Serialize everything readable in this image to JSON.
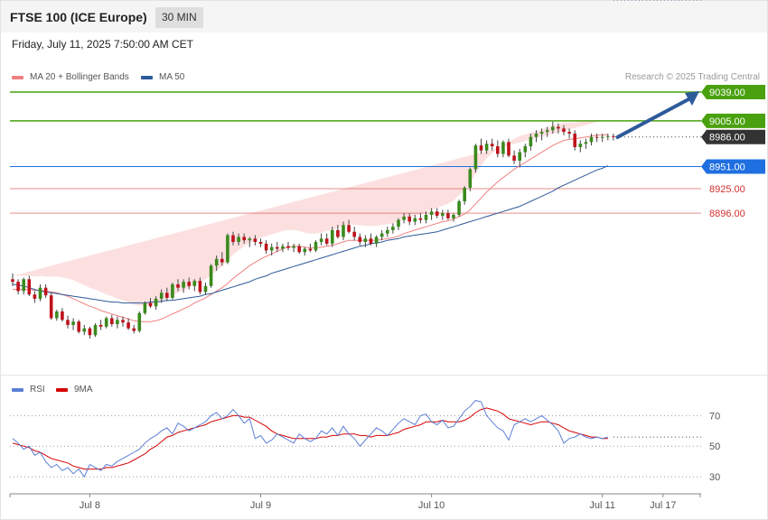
{
  "header": {
    "title": "FTSE 100 (ICE Europe)",
    "timeframe": "30 MIN"
  },
  "datetime": "Friday, July 11, 2025 7:50:00 AM CET",
  "legend": {
    "ma20": {
      "label": "MA 20 + Bollinger Bands",
      "color": "#f08080"
    },
    "ma50": {
      "label": "MA 50",
      "color": "#2d5a9a"
    }
  },
  "credit": "Research © 2025 Trading Central",
  "rsi_legend": {
    "rsi": {
      "label": "RSI",
      "color": "#5b7fd6"
    },
    "ma9": {
      "label": "9MA",
      "color": "#d60000"
    }
  },
  "chart_data": {
    "type": "candlestick",
    "ylim": [
      8700,
      9055
    ],
    "levels": [
      {
        "value": 9039.0,
        "label": "9039.00",
        "kind": "resistance",
        "color": "#4aa10f"
      },
      {
        "value": 9005.0,
        "label": "9005.00",
        "kind": "resistance",
        "color": "#4aa10f"
      },
      {
        "value": 8986.0,
        "label": "8986.00",
        "kind": "current",
        "color": "#333333"
      },
      {
        "value": 8951.0,
        "label": "8951.00",
        "kind": "support",
        "color": "#1f6fe0"
      },
      {
        "value": 8925.0,
        "label": "8925.00",
        "kind": "support",
        "color": "#d32f2f"
      },
      {
        "value": 8896.0,
        "label": "8896.00",
        "kind": "support",
        "color": "#d32f2f"
      }
    ],
    "candles": [
      [
        8818,
        8825,
        8810,
        8815
      ],
      [
        8815,
        8818,
        8800,
        8804
      ],
      [
        8804,
        8820,
        8800,
        8818
      ],
      [
        8818,
        8822,
        8798,
        8800
      ],
      [
        8800,
        8804,
        8790,
        8795
      ],
      [
        8795,
        8812,
        8792,
        8808
      ],
      [
        8808,
        8812,
        8796,
        8799
      ],
      [
        8799,
        8802,
        8770,
        8772
      ],
      [
        8772,
        8782,
        8769,
        8780
      ],
      [
        8780,
        8784,
        8768,
        8770
      ],
      [
        8770,
        8775,
        8760,
        8764
      ],
      [
        8764,
        8772,
        8758,
        8768
      ],
      [
        8768,
        8770,
        8754,
        8756
      ],
      [
        8756,
        8764,
        8752,
        8760
      ],
      [
        8760,
        8762,
        8748,
        8752
      ],
      [
        8752,
        8766,
        8750,
        8764
      ],
      [
        8764,
        8770,
        8758,
        8762
      ],
      [
        8762,
        8774,
        8760,
        8772
      ],
      [
        8772,
        8776,
        8762,
        8765
      ],
      [
        8765,
        8774,
        8760,
        8770
      ],
      [
        8770,
        8774,
        8762,
        8767
      ],
      [
        8767,
        8772,
        8758,
        8760
      ],
      [
        8760,
        8764,
        8754,
        8757
      ],
      [
        8757,
        8780,
        8755,
        8778
      ],
      [
        8778,
        8792,
        8776,
        8790
      ],
      [
        8790,
        8796,
        8784,
        8786
      ],
      [
        8786,
        8798,
        8782,
        8795
      ],
      [
        8795,
        8806,
        8790,
        8802
      ],
      [
        8802,
        8808,
        8792,
        8796
      ],
      [
        8796,
        8814,
        8794,
        8812
      ],
      [
        8812,
        8818,
        8804,
        8808
      ],
      [
        8808,
        8818,
        8802,
        8815
      ],
      [
        8815,
        8820,
        8806,
        8810
      ],
      [
        8810,
        8818,
        8804,
        8816
      ],
      [
        8816,
        8820,
        8800,
        8803
      ],
      [
        8803,
        8814,
        8800,
        8810
      ],
      [
        8810,
        8836,
        8808,
        8834
      ],
      [
        8834,
        8846,
        8828,
        8842
      ],
      [
        8842,
        8850,
        8834,
        8838
      ],
      [
        8838,
        8872,
        8836,
        8870
      ],
      [
        8870,
        8874,
        8858,
        8862
      ],
      [
        8862,
        8872,
        8858,
        8868
      ],
      [
        8868,
        8872,
        8860,
        8864
      ],
      [
        8864,
        8868,
        8856,
        8866
      ],
      [
        8866,
        8870,
        8858,
        8862
      ],
      [
        8862,
        8866,
        8856,
        8860
      ],
      [
        8860,
        8864,
        8848,
        8852
      ],
      [
        8852,
        8860,
        8846,
        8856
      ],
      [
        8856,
        8862,
        8850,
        8854
      ],
      [
        8854,
        8860,
        8850,
        8857
      ],
      [
        8857,
        8862,
        8852,
        8855
      ],
      [
        8855,
        8860,
        8850,
        8857
      ],
      [
        8857,
        8860,
        8848,
        8850
      ],
      [
        8850,
        8856,
        8846,
        8854
      ],
      [
        8854,
        8860,
        8850,
        8852
      ],
      [
        8852,
        8864,
        8850,
        8862
      ],
      [
        8862,
        8872,
        8858,
        8866
      ],
      [
        8866,
        8872,
        8858,
        8860
      ],
      [
        8860,
        8880,
        8856,
        8876
      ],
      [
        8876,
        8882,
        8866,
        8868
      ],
      [
        8868,
        8886,
        8864,
        8882
      ],
      [
        8882,
        8888,
        8872,
        8874
      ],
      [
        8874,
        8880,
        8864,
        8868
      ],
      [
        8868,
        8872,
        8858,
        8862
      ],
      [
        8862,
        8870,
        8856,
        8866
      ],
      [
        8866,
        8872,
        8858,
        8860
      ],
      [
        8860,
        8870,
        8856,
        8868
      ],
      [
        8868,
        8876,
        8864,
        8872
      ],
      [
        8872,
        8880,
        8868,
        8876
      ],
      [
        8876,
        8884,
        8872,
        8880
      ],
      [
        8880,
        8890,
        8876,
        8888
      ],
      [
        8888,
        8896,
        8884,
        8892
      ],
      [
        8892,
        8896,
        8882,
        8886
      ],
      [
        8886,
        8894,
        8882,
        8890
      ],
      [
        8890,
        8896,
        8884,
        8888
      ],
      [
        8888,
        8898,
        8884,
        8894
      ],
      [
        8894,
        8902,
        8888,
        8898
      ],
      [
        8898,
        8902,
        8890,
        8893
      ],
      [
        8893,
        8900,
        8888,
        8896
      ],
      [
        8896,
        8900,
        8888,
        8890
      ],
      [
        8890,
        8896,
        8886,
        8894
      ],
      [
        8894,
        8912,
        8892,
        8910
      ],
      [
        8910,
        8928,
        8906,
        8926
      ],
      [
        8926,
        8950,
        8922,
        8948
      ],
      [
        8948,
        8978,
        8944,
        8976
      ],
      [
        8976,
        8984,
        8966,
        8970
      ],
      [
        8970,
        8982,
        8966,
        8978
      ],
      [
        8978,
        8984,
        8970,
        8975
      ],
      [
        8975,
        8982,
        8962,
        8966
      ],
      [
        8966,
        8982,
        8962,
        8980
      ],
      [
        8980,
        8984,
        8962,
        8964
      ],
      [
        8964,
        8970,
        8954,
        8958
      ],
      [
        8958,
        8972,
        8950,
        8968
      ],
      [
        8968,
        8978,
        8962,
        8975
      ],
      [
        8975,
        8990,
        8970,
        8986
      ],
      [
        8986,
        8994,
        8980,
        8990
      ],
      [
        8990,
        8996,
        8982,
        8992
      ],
      [
        8992,
        8998,
        8986,
        8994
      ],
      [
        8994,
        9004,
        8990,
        8998
      ],
      [
        8998,
        9002,
        8990,
        8996
      ],
      [
        8996,
        9000,
        8988,
        8992
      ],
      [
        8992,
        8996,
        8984,
        8990
      ],
      [
        8990,
        8994,
        8970,
        8974
      ],
      [
        8974,
        8982,
        8968,
        8978
      ],
      [
        8978,
        8984,
        8972,
        8980
      ],
      [
        8980,
        8990,
        8976,
        8986
      ],
      [
        8986,
        8990,
        8980,
        8985
      ],
      [
        8985,
        8990,
        8980,
        8986
      ],
      [
        8986,
        8990,
        8982,
        8987
      ],
      [
        8987,
        8990,
        8982,
        8986
      ]
    ],
    "ma20": [
      8806,
      8806,
      8806,
      8806,
      8805,
      8805,
      8804,
      8803,
      8802,
      8800,
      8798,
      8795,
      8792,
      8789,
      8786,
      8784,
      8781,
      8779,
      8777,
      8775,
      8773,
      8771,
      8769,
      8768,
      8768,
      8768,
      8769,
      8771,
      8774,
      8777,
      8780,
      8783,
      8786,
      8790,
      8793,
      8796,
      8800,
      8804,
      8808,
      8813,
      8819,
      8824,
      8829,
      8834,
      8838,
      8842,
      8845,
      8848,
      8851,
      8854,
      8856,
      8857,
      8857,
      8856,
      8855,
      8855,
      8856,
      8857,
      8858,
      8860,
      8862,
      8864,
      8864,
      8864,
      8864,
      8864,
      8864,
      8865,
      8866,
      8867,
      8869,
      8872,
      8874,
      8876,
      8878,
      8880,
      8882,
      8884,
      8886,
      8887,
      8889,
      8892,
      8895,
      8900,
      8907,
      8914,
      8921,
      8927,
      8933,
      8938,
      8943,
      8948,
      8952,
      8956,
      8960,
      8964,
      8968,
      8972,
      8976,
      8979,
      8982,
      8983,
      8984,
      8985,
      8986,
      8987,
      8988,
      8988,
      8989
    ],
    "ma50": [
      8812,
      8811,
      8810,
      8808,
      8806,
      8804,
      8803,
      8802,
      8801,
      8800,
      8799,
      8798,
      8797,
      8796,
      8795,
      8794,
      8793,
      8792,
      8791,
      8791,
      8790,
      8790,
      8790,
      8790,
      8790,
      8791,
      8791,
      8792,
      8793,
      8793,
      8794,
      8795,
      8796,
      8797,
      8798,
      8800,
      8801,
      8803,
      8805,
      8807,
      8809,
      8811,
      8813,
      8815,
      8818,
      8820,
      8822,
      8825,
      8827,
      8829,
      8831,
      8833,
      8835,
      8837,
      8839,
      8841,
      8843,
      8845,
      8847,
      8849,
      8851,
      8853,
      8855,
      8857,
      8858,
      8860,
      8861,
      8862,
      8864,
      8865,
      8866,
      8868,
      8869,
      8870,
      8871,
      8872,
      8873,
      8874,
      8876,
      8878,
      8880,
      8882,
      8884,
      8886,
      8888,
      8890,
      8892,
      8894,
      8896,
      8898,
      8900,
      8902,
      8904,
      8907,
      8910,
      8913,
      8916,
      8919,
      8922,
      8926,
      8929,
      8932,
      8935,
      8938,
      8941,
      8944,
      8947,
      8949,
      8952
    ],
    "band": [
      16,
      16,
      16,
      16,
      16,
      17,
      17,
      18,
      19,
      20,
      21,
      22,
      22,
      22,
      22,
      22,
      22,
      21,
      21,
      20,
      20,
      20,
      19,
      19,
      19,
      20,
      20,
      21,
      21,
      21,
      22,
      22,
      22,
      22,
      22,
      22,
      23,
      24,
      25,
      27,
      28,
      28,
      28,
      27,
      26,
      25,
      24,
      23,
      22,
      21,
      20,
      19,
      18,
      17,
      17,
      17,
      17,
      18,
      18,
      19,
      19,
      19,
      18,
      18,
      17,
      17,
      17,
      17,
      17,
      17,
      17,
      17,
      17,
      17,
      17,
      17,
      18,
      18,
      19,
      20,
      22,
      25,
      28,
      32,
      36,
      38,
      40,
      40,
      39,
      38,
      37,
      36,
      35,
      33,
      31,
      29,
      27,
      25,
      24,
      22,
      21,
      20,
      19,
      19,
      18,
      18,
      18,
      18,
      18
    ],
    "x_ticks": [
      {
        "label": "Jul 8",
        "index": 14
      },
      {
        "label": "Jul 9",
        "index": 45
      },
      {
        "label": "Jul 10",
        "index": 76
      },
      {
        "label": "Jul 11",
        "index": 107
      },
      {
        "label": "Jul 17",
        "index": 118
      }
    ],
    "rsi": {
      "ylim": [
        20,
        85
      ],
      "levels": [
        {
          "value": 70,
          "label": "70"
        },
        {
          "value": 50,
          "label": "50"
        },
        {
          "value": 30,
          "label": "30"
        }
      ],
      "rsi_values": [
        55,
        52,
        48,
        50,
        44,
        46,
        40,
        36,
        38,
        34,
        36,
        32,
        35,
        30,
        38,
        36,
        34,
        38,
        37,
        40,
        42,
        44,
        46,
        48,
        52,
        55,
        57,
        60,
        62,
        58,
        65,
        63,
        60,
        62,
        64,
        66,
        70,
        72,
        68,
        70,
        74,
        70,
        65,
        68,
        55,
        57,
        52,
        54,
        58,
        56,
        54,
        52,
        58,
        55,
        53,
        55,
        60,
        58,
        62,
        57,
        63,
        58,
        55,
        50,
        54,
        58,
        62,
        60,
        57,
        61,
        65,
        68,
        66,
        64,
        70,
        71,
        66,
        64,
        67,
        62,
        63,
        68,
        73,
        76,
        80,
        79,
        70,
        66,
        62,
        60,
        54,
        64,
        66,
        68,
        66,
        68,
        70,
        67,
        64,
        60,
        52,
        55,
        56,
        58,
        56,
        55,
        56,
        55,
        56
      ],
      "ma9_values": [
        52,
        51,
        50,
        49,
        47,
        46,
        44,
        42,
        41,
        40,
        39,
        37,
        36,
        35,
        35,
        35,
        35,
        36,
        36,
        37,
        38,
        39,
        41,
        43,
        45,
        48,
        50,
        53,
        56,
        57,
        59,
        60,
        61,
        62,
        63,
        64,
        66,
        67,
        68,
        69,
        70,
        70,
        69,
        69,
        67,
        65,
        63,
        60,
        58,
        57,
        56,
        55,
        55,
        55,
        55,
        55,
        56,
        56,
        57,
        57,
        58,
        58,
        58,
        57,
        57,
        56,
        57,
        57,
        57,
        58,
        59,
        61,
        62,
        63,
        64,
        66,
        66,
        66,
        67,
        66,
        66,
        66,
        67,
        69,
        72,
        74,
        75,
        74,
        73,
        71,
        68,
        67,
        66,
        65,
        64,
        65,
        66,
        66,
        65,
        64,
        62,
        60,
        59,
        58,
        57,
        56,
        56,
        55,
        55
      ]
    }
  }
}
